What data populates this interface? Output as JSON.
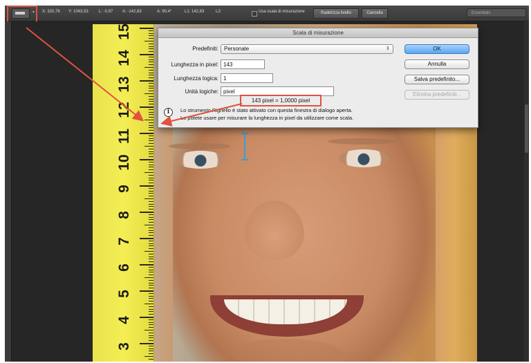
{
  "options_bar": {
    "x_label": "X: 320,76",
    "y_label": "Y: 1043,53",
    "l_label": "L: -0,97",
    "a_label": "A: -142,83",
    "a2_label": "A: 90,4°",
    "l1_label": "L1: 142,83",
    "l2_label": "L2:",
    "checkbox_label": "Usa scala di misurazione",
    "straighten_button": "Raddrizza livello",
    "clear_button": "Cancella",
    "workspace_label": "Essentials"
  },
  "ruler": {
    "numbers": [
      "15",
      "14",
      "13",
      "12",
      "11",
      "10",
      "9",
      "8",
      "7",
      "6",
      "5",
      "4",
      "3"
    ]
  },
  "dialog": {
    "title": "Scala di misurazione",
    "preset_label": "Predefiniti:",
    "preset_value": "Personale",
    "pixel_length_label": "Lunghezza in pixel:",
    "pixel_length_value": "143",
    "logical_length_label": "Lunghezza logica:",
    "logical_length_value": "1",
    "logical_units_label": "Unità logiche:",
    "logical_units_value": "pixel",
    "ratio_text": "143 pixel = 1,0000 pixel",
    "info_line_1": "Lo strumento Righello è stato attivato con questa finestra di dialogo aperta.",
    "info_line_2": "Lo potete usare per misurare la lunghezza in pixel da utilizzare come scala.",
    "ok_button": "OK",
    "cancel_button": "Annulla",
    "save_preset_button": "Salva predefinito...",
    "delete_preset_button": "Elimina predefiniti..."
  },
  "colors": {
    "annotation_red": "#e0523f",
    "ruler_yellow": "#f4ee55",
    "measure_blue": "#3a9ed4"
  }
}
